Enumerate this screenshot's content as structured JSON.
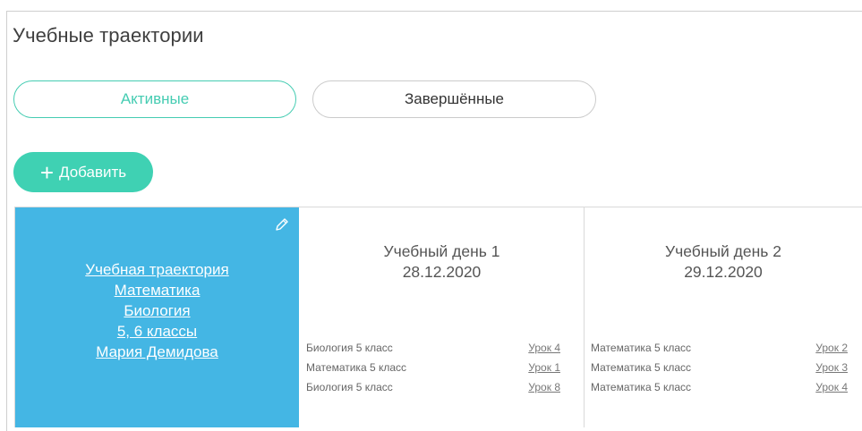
{
  "page": {
    "title": "Учебные траектории"
  },
  "filters": {
    "active_label": "Активные",
    "done_label": "Завершённые"
  },
  "add_button": {
    "label": "Добавить"
  },
  "trajectory_card": {
    "lines": [
      "Учебная траектория",
      "Математика",
      "Биология",
      "5, 6 классы",
      "Мария Демидова"
    ],
    "icon": "pencil-icon"
  },
  "days": [
    {
      "title": "Учебный день 1",
      "date": "28.12.2020",
      "items": [
        {
          "subject": "Биология 5 класс",
          "lesson": "Урок 4"
        },
        {
          "subject": "Математика 5 класс",
          "lesson": "Урок 1"
        },
        {
          "subject": "Биология 5 класс",
          "lesson": "Урок 8"
        }
      ]
    },
    {
      "title": "Учебный день 2",
      "date": "29.12.2020",
      "items": [
        {
          "subject": "Математика 5 класс",
          "lesson": "Урок 2"
        },
        {
          "subject": "Математика 5 класс",
          "lesson": "Урок 3"
        },
        {
          "subject": "Математика 5 класс",
          "lesson": "Урок 4"
        }
      ]
    }
  ],
  "colors": {
    "accent": "#3fd1b3",
    "card_bg": "#44b6e4",
    "border": "#d9d9d9"
  }
}
